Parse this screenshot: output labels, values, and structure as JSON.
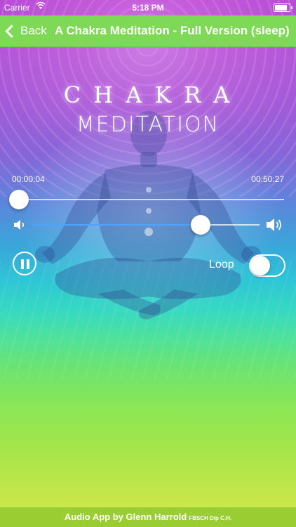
{
  "status_bar": {
    "carrier": "Carrier",
    "wifi_icon": "wifi-icon",
    "time": "5:18 PM",
    "battery_icon": "battery-icon"
  },
  "nav": {
    "back_label": "Back",
    "title": "A Chakra Meditation - Full Version (sleep)",
    "color": "#7ed957"
  },
  "artwork": {
    "logo_line1": "CHAKRA",
    "logo_line2": "MEDITATION"
  },
  "player": {
    "elapsed": "00:00:04",
    "total": "00:50:27",
    "progress_fraction": 0.001,
    "volume_fraction": 0.74,
    "volume_low_icon": "speaker-low-icon",
    "volume_high_icon": "speaker-high-icon",
    "play_state_icon": "pause-icon",
    "loop_label": "Loop",
    "loop_enabled": false
  },
  "footer": {
    "text": "Audio App by Glenn Harrold",
    "credentials": "FBSCH Dip C.H."
  },
  "colors": {
    "accent": "#4da3ff",
    "footer": "#9acd32"
  }
}
